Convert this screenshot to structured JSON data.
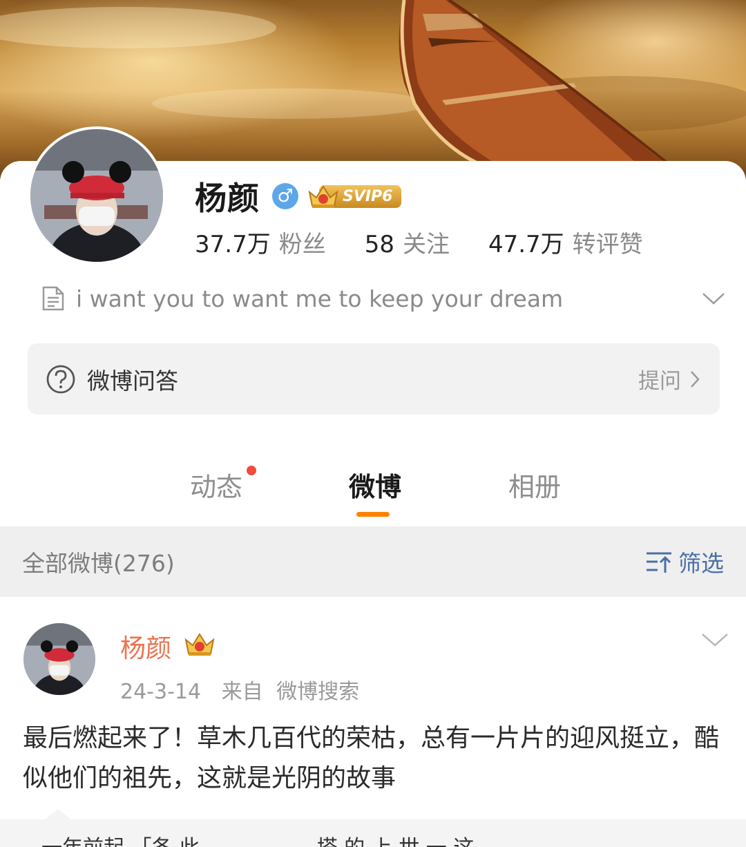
{
  "profile": {
    "name": "杨颜",
    "gender_symbol": "♂",
    "vip_badge": "SVIP6",
    "stats": [
      {
        "value": "37.7万",
        "label": "粉丝"
      },
      {
        "value": "58",
        "label": "关注"
      },
      {
        "value": "47.7万",
        "label": "转评赞"
      }
    ],
    "bio": "i want you to want me to keep your dream"
  },
  "qa": {
    "label": "微博问答",
    "action": "提问"
  },
  "tabs": {
    "items": [
      "动态",
      "微博",
      "相册"
    ],
    "active": "微博"
  },
  "filter_bar": {
    "title": "全部微博(276)",
    "filter_label": "筛选"
  },
  "post": {
    "author": "杨颜",
    "date": "24-3-14",
    "source_prefix": "来自",
    "source": "微博搜索",
    "text": "最后燃起来了！草木几百代的荣枯，总有一片片的迎风挺立，酷似他们的祖先，这就是光阴的故事",
    "next_post_partial": "一年前起 「各 此",
    "next_post_tail": "塔 的 上 世 一 这"
  },
  "colors": {
    "accent": "#ff8200",
    "username": "#eb7350",
    "link_blue": "#4a6fa5",
    "notification_dot": "#f24b3b"
  }
}
